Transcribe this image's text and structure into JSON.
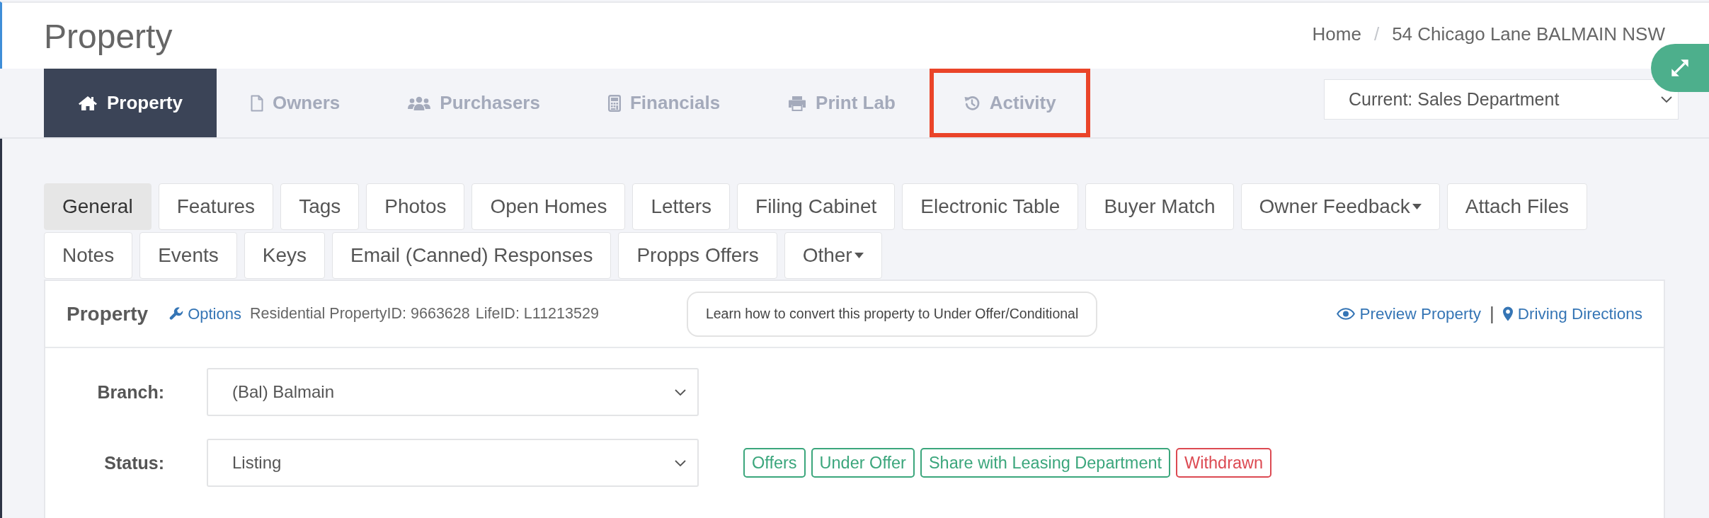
{
  "page": {
    "title": "Property",
    "breadcrumb": [
      {
        "label": "Home"
      },
      {
        "label": "54 Chicago Lane BALMAIN NSW"
      }
    ],
    "breadcrumb_separator": "/"
  },
  "nav_tabs": [
    {
      "label": "Property",
      "selected": true,
      "highlighted": false
    },
    {
      "label": "Owners",
      "selected": false,
      "highlighted": false
    },
    {
      "label": "Purchasers",
      "selected": false,
      "highlighted": false
    },
    {
      "label": "Financials",
      "selected": false,
      "highlighted": false
    },
    {
      "label": "Print Lab",
      "selected": false,
      "highlighted": false
    },
    {
      "label": "Activity",
      "selected": false,
      "highlighted": true
    }
  ],
  "department_select": {
    "value": "Current: Sales Department"
  },
  "sub_tabs": [
    {
      "label": "General",
      "selected": true,
      "dropdown": false
    },
    {
      "label": "Features",
      "selected": false,
      "dropdown": false
    },
    {
      "label": "Tags",
      "selected": false,
      "dropdown": false
    },
    {
      "label": "Photos",
      "selected": false,
      "dropdown": false
    },
    {
      "label": "Open Homes",
      "selected": false,
      "dropdown": false
    },
    {
      "label": "Letters",
      "selected": false,
      "dropdown": false
    },
    {
      "label": "Filing Cabinet",
      "selected": false,
      "dropdown": false
    },
    {
      "label": "Electronic Table",
      "selected": false,
      "dropdown": false
    },
    {
      "label": "Buyer Match",
      "selected": false,
      "dropdown": false
    },
    {
      "label": "Owner Feedback",
      "selected": false,
      "dropdown": true
    },
    {
      "label": "Attach Files",
      "selected": false,
      "dropdown": false
    },
    {
      "label": "Notes",
      "selected": false,
      "dropdown": false
    },
    {
      "label": "Events",
      "selected": false,
      "dropdown": false
    },
    {
      "label": "Keys",
      "selected": false,
      "dropdown": false
    },
    {
      "label": "Email (Canned) Responses",
      "selected": false,
      "dropdown": false
    },
    {
      "label": "Propps Offers",
      "selected": false,
      "dropdown": false
    },
    {
      "label": "Other",
      "selected": false,
      "dropdown": true
    }
  ],
  "panel": {
    "title": "Property",
    "options_link": "Options",
    "property_id": "Residential PropertyID: 9663628",
    "life_id": "LifeID: L11213529",
    "help_button": "Learn how to convert this property to Under Offer/Conditional",
    "links": [
      "Preview Property",
      "Driving Directions"
    ],
    "link_separator": "|",
    "fields": [
      {
        "label": "Branch:",
        "value": "(Bal) Balmain"
      },
      {
        "label": "Status:",
        "value": "Listing",
        "actions": [
          {
            "label": "Offers",
            "color": "#3ba67c"
          },
          {
            "label": "Under Offer",
            "color": "#3ba67c"
          },
          {
            "label": "Share with Leasing Department",
            "color": "#3ba67c"
          },
          {
            "label": "Withdrawn",
            "color": "#dc4a52"
          }
        ]
      }
    ]
  }
}
